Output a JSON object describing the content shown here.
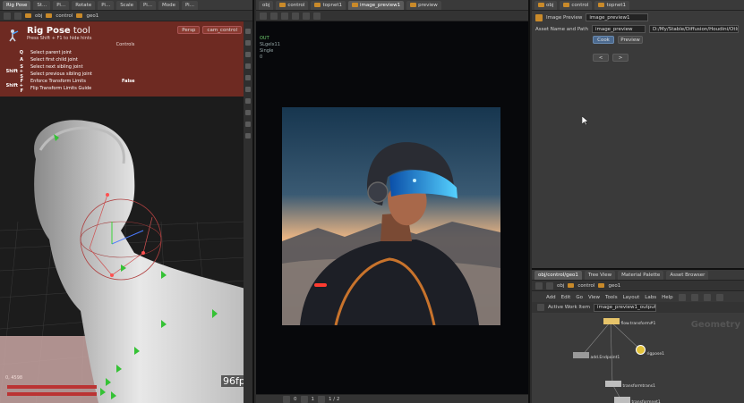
{
  "left_pane": {
    "tabs": [
      {
        "label": "Rig Pose",
        "active": true
      },
      {
        "label": "St..."
      },
      {
        "label": "Pi..."
      },
      {
        "label": "Rotate"
      },
      {
        "label": "Pi..."
      },
      {
        "label": "Scale"
      },
      {
        "label": "Pi..."
      },
      {
        "label": "Mode"
      },
      {
        "label": "Pi..."
      }
    ],
    "path": [
      "obj",
      "control",
      "geo1"
    ],
    "hud": {
      "title_bold": "Rig Pose",
      "title_thin": " tool",
      "subtitle": "Press Shift + F1 to hide hints",
      "controls_header": "Controls",
      "controls": [
        {
          "key": "Q",
          "desc": "Select parent joint"
        },
        {
          "key": "A",
          "desc": "Select first child joint"
        },
        {
          "key": "S",
          "desc": "Select next sibling joint"
        },
        {
          "key": "Shift + S",
          "desc": "Select previous sibling joint"
        },
        {
          "key": "F",
          "desc": "Enforce Transform Limits",
          "value": "False"
        },
        {
          "key": "Shift + F",
          "desc": "Flip Transform Limits Guide"
        }
      ],
      "btn_persp": "Persp",
      "btn_cam": "cam_control"
    },
    "fps": "96fps",
    "coord": "0, 4598"
  },
  "middle_pane": {
    "tabs": [
      {
        "label": "obj"
      },
      {
        "label": "control"
      },
      {
        "label": "topnet1"
      },
      {
        "label": "image_preview1",
        "active": true
      },
      {
        "label": "preview"
      }
    ],
    "overlay": {
      "line1": "OUT",
      "line2": "SLgelx11",
      "line3": "Single",
      "line4": "0"
    },
    "bottom": [
      "0",
      "1",
      "1 / 2"
    ]
  },
  "right_top": {
    "tabs": [
      {
        "label": "obj"
      },
      {
        "label": "control"
      },
      {
        "label": "topnet1"
      }
    ],
    "node_type": "Image Preview",
    "node_name": "image_preview1",
    "asset_label": "Asset Name and Path",
    "asset_value": "image_preview",
    "asset_path": "D:/My/Stable/Diffusion/Houdini/Otls/sfx...",
    "buttons": [
      "Cook",
      "Preview"
    ],
    "small_buttons": [
      "<",
      ">"
    ]
  },
  "right_bottom": {
    "tabs": [
      {
        "label": "obj/control/geo1"
      },
      {
        "label": "Tree View"
      },
      {
        "label": "Material Palette"
      },
      {
        "label": "Asset Browser"
      }
    ],
    "path": [
      "obj",
      "control",
      "geo1"
    ],
    "menu": [
      "Add",
      "Edit",
      "Go",
      "View",
      "Tools",
      "Layout",
      "Labs",
      "Help"
    ],
    "work_item": "Active Work Item",
    "work_value": "image_preview1_output#0_001",
    "context_label": "Geometry",
    "nodes": {
      "n1": "flow.transform#1",
      "n2": "add.Endpoint1",
      "n3": "rigpose1",
      "n4": "transformtrans1",
      "n5": "transformnet1"
    }
  },
  "colors": {
    "hud_red": "#6e2a22",
    "folder_orange": "#c98a2a",
    "accent_blue": "#4c6a8f"
  }
}
